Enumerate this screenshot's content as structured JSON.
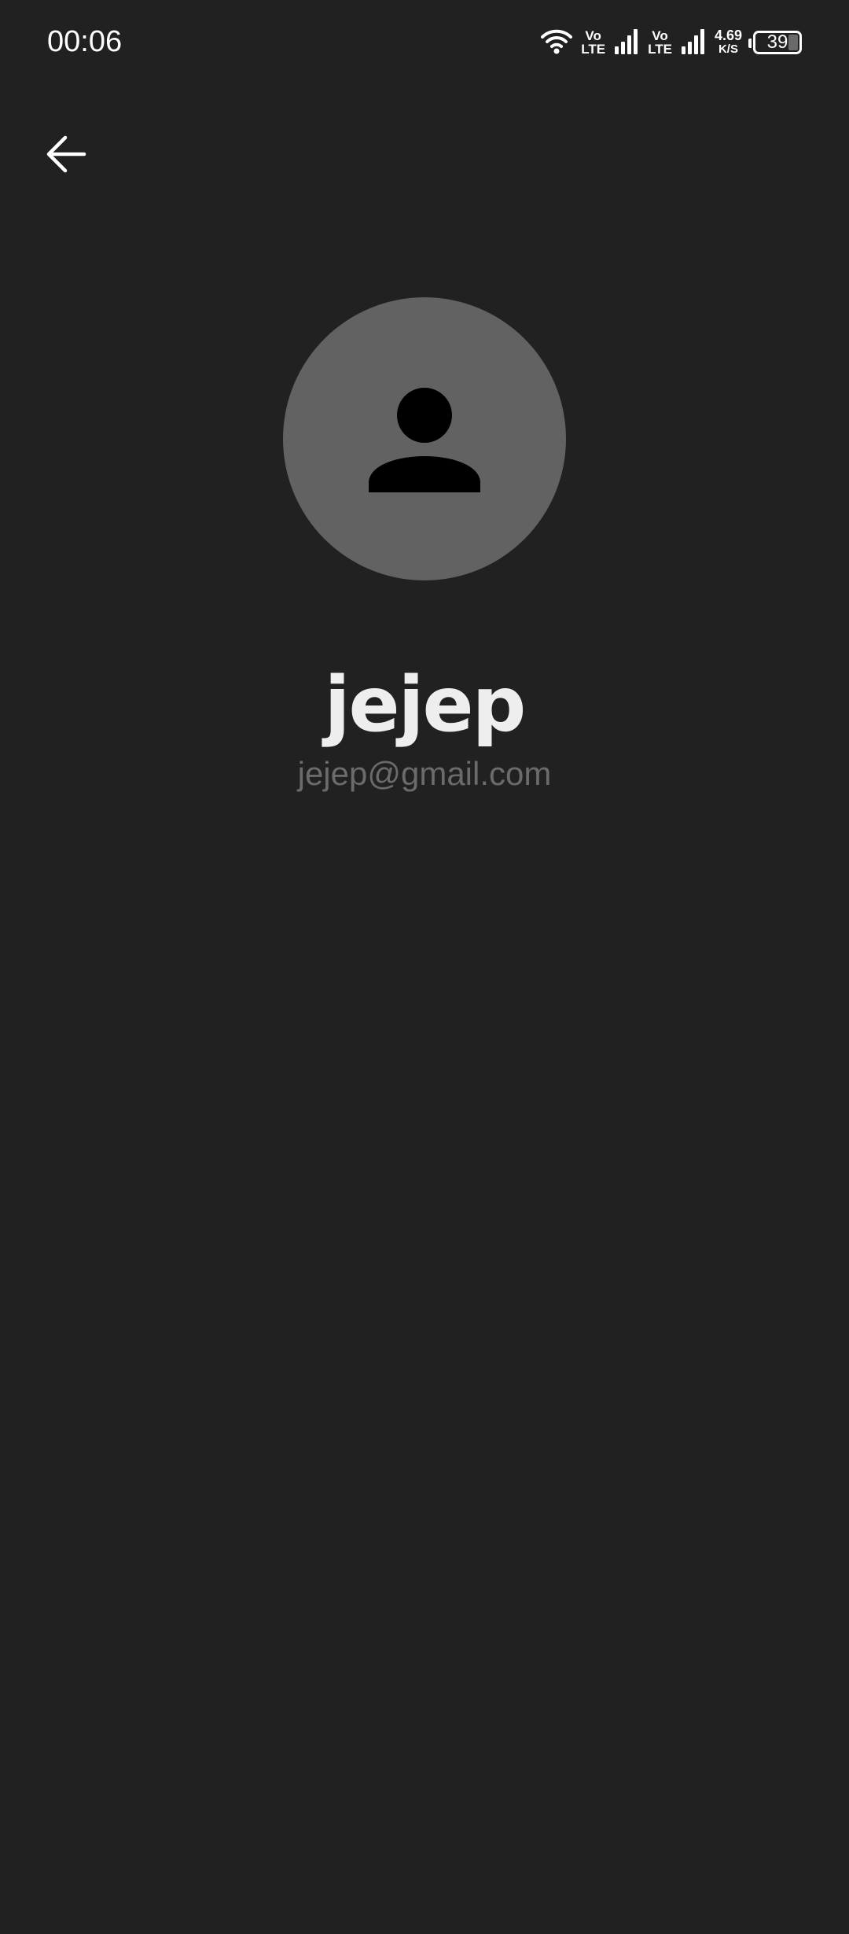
{
  "status_bar": {
    "time": "00:06",
    "sim1": {
      "top": "Vo",
      "bottom": "LTE"
    },
    "sim2": {
      "top": "Vo",
      "bottom": "LTE"
    },
    "net_speed_value": "4.69",
    "net_speed_unit": "K/S",
    "battery_level": "39",
    "icons": [
      "wifi-icon",
      "signal-icon",
      "signal-icon",
      "battery-icon"
    ]
  },
  "toolbar": {
    "back_icon": "arrow-back-icon"
  },
  "profile": {
    "avatar_icon": "person-icon",
    "name": "jejep",
    "email": "jejep@gmail.com"
  },
  "colors": {
    "background": "#212121",
    "avatar_bg": "#626262",
    "name_text": "#eeeeee",
    "email_text": "#6b6b6b"
  }
}
